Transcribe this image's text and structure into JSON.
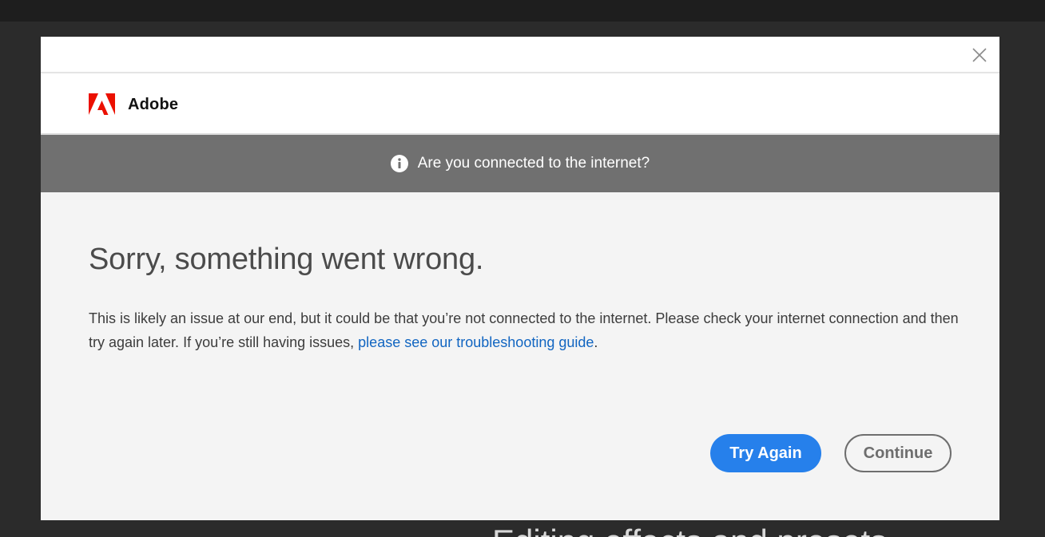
{
  "background": {
    "partial_text": "Editing effects and presets"
  },
  "dialog": {
    "close_icon": "close-icon",
    "brand": {
      "logo_icon": "adobe-logo-icon",
      "name": "Adobe",
      "logo_color": "#eb1000"
    },
    "notice": {
      "icon": "info-icon",
      "text": "Are you connected to the internet?"
    },
    "heading": "Sorry, something went wrong.",
    "message": {
      "text": "This is likely an issue at our end, but it could be that you’re not connected to the internet. Please check your internet connection and then try again later. If you’re still having issues, ",
      "link_text": "please see our troubleshooting guide",
      "suffix": "."
    },
    "buttons": {
      "try_again": "Try Again",
      "continue": "Continue"
    },
    "colors": {
      "primary": "#2680eb",
      "link": "#1165c1",
      "notice_bg": "#707070"
    }
  }
}
